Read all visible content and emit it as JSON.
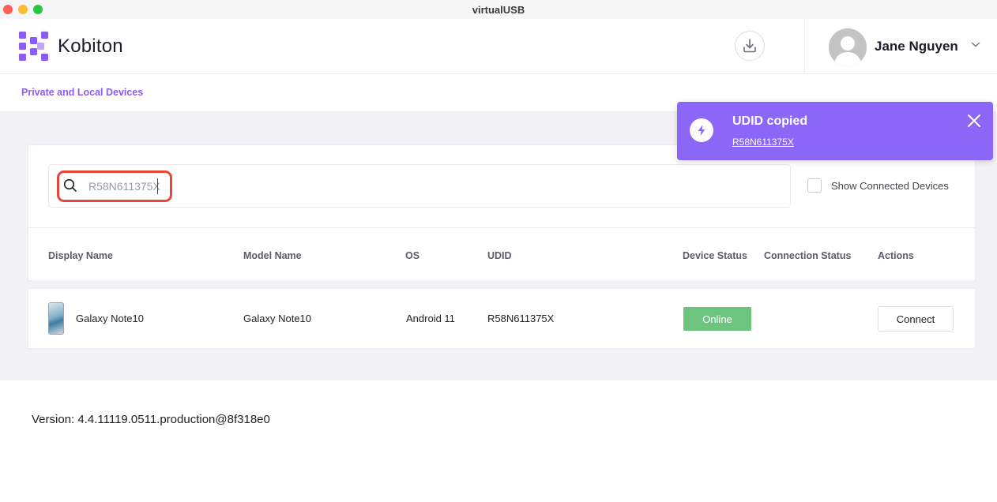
{
  "window": {
    "title": "virtualUSB"
  },
  "header": {
    "logo_text": "Kobiton",
    "user_name": "Jane Nguyen"
  },
  "nav": {
    "link": "Private and Local Devices"
  },
  "search": {
    "value": "R58N611375X"
  },
  "filter": {
    "show_connected_label": "Show Connected Devices"
  },
  "table": {
    "headers": {
      "display_name": "Display Name",
      "model_name": "Model Name",
      "os": "OS",
      "udid": "UDID",
      "device_status": "Device Status",
      "connection_status": "Connection Status",
      "actions": "Actions"
    },
    "rows": [
      {
        "display_name": "Galaxy Note10",
        "model_name": "Galaxy Note10",
        "os": "Android 11",
        "udid": "R58N611375X",
        "device_status": "Online",
        "action": "Connect"
      }
    ]
  },
  "footer": {
    "version": "Version: 4.4.11119.0511.production@8f318e0"
  },
  "toast": {
    "title": "UDID copied",
    "link": "R58N611375X"
  },
  "colors": {
    "accent": "#8b5cf6",
    "toast_bg": "#8b66f7",
    "online": "#6cc47f",
    "highlight": "#e8453c"
  }
}
